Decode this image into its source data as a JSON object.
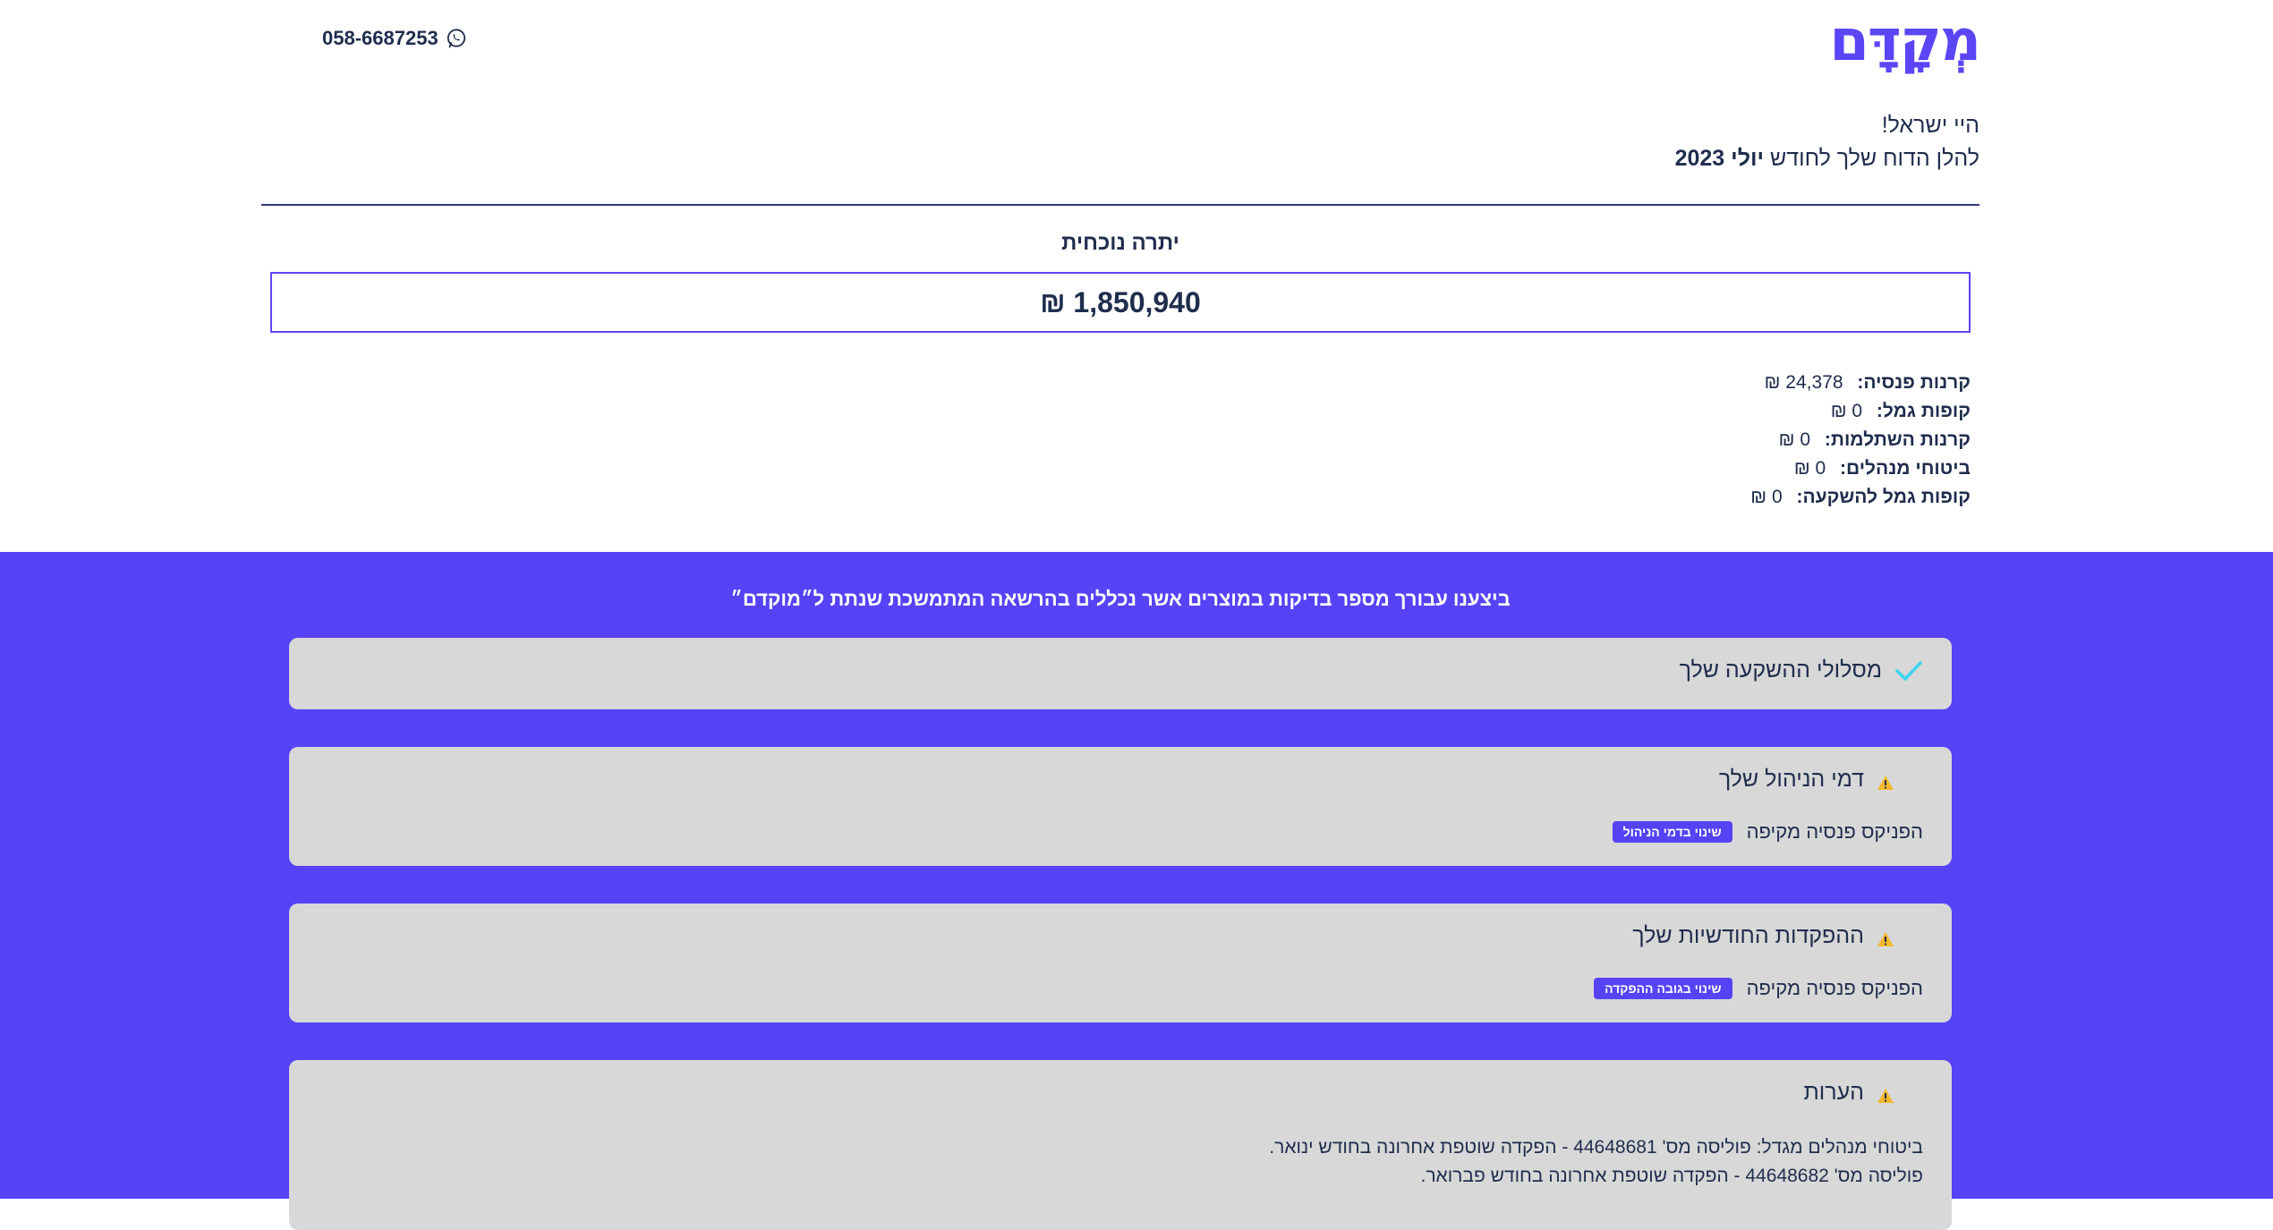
{
  "header": {
    "logo": "מְקָדָּם",
    "phone": "058-6687253"
  },
  "greeting": {
    "hello": "היי ישראל!",
    "report_prefix": "להלן הדוח שלך לחודש",
    "report_month": "יולי 2023"
  },
  "balance": {
    "title": "יתרה נוכחית",
    "amount": "1,850,940 ₪"
  },
  "funds": [
    {
      "label": "קרנות פנסיה:",
      "value": "24,378 ₪"
    },
    {
      "label": "קופות גמל:",
      "value": "0 ₪"
    },
    {
      "label": "קרנות השתלמות:",
      "value": "0 ₪"
    },
    {
      "label": "ביטוחי מנהלים:",
      "value": "0 ₪"
    },
    {
      "label": "קופות גמל להשקעה:",
      "value": "0 ₪"
    }
  ],
  "checks": {
    "intro": "ביצענו עבורך מספר בדיקות במוצרים אשר נכללים בהרשאה המתמשכת שנתת ל״מוקדם״",
    "investment": {
      "title": "מסלולי ההשקעה שלך",
      "icon": "check-icon",
      "icon_color": "#3fd3f0"
    },
    "management_fees": {
      "title": "דמי הניהול שלך",
      "icon": "warning-icon",
      "row_text": "הפניקס פנסיה מקיפה",
      "action": "שינוי בדמי הניהול"
    },
    "monthly_deposits": {
      "title": "ההפקדות החודשיות שלך",
      "icon": "warning-icon",
      "row_text": "הפניקס פנסיה מקיפה",
      "action": "שינוי בגובה ההפקדה"
    },
    "notes": {
      "title": "הערות",
      "icon": "warning-icon",
      "lines": [
        "ביטוחי מנהלים מגדל: פוליסה מס' 44648681 - הפקדה שוטפת אחרונה בחודש ינואר.",
        "פוליסה מס' 44648682 - הפקדה שוטפת אחרונה בחודש פברואר."
      ]
    }
  },
  "colors": {
    "brand": "#5543f5",
    "text": "#1f2d4d",
    "card_bg": "#d8d8d8",
    "warning": "#f5b82e"
  }
}
